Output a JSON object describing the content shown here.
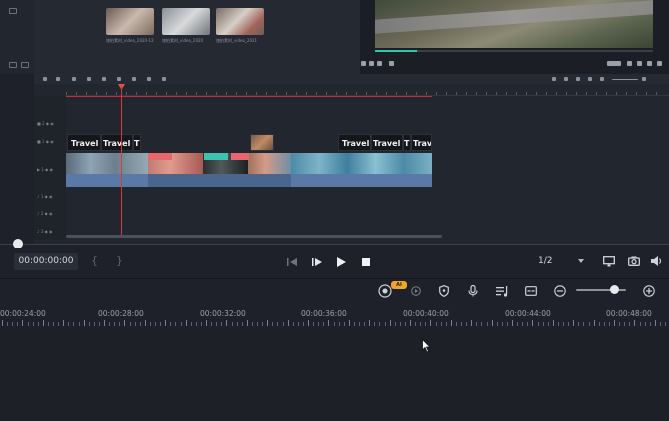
{
  "media": {
    "thumbnails": [
      {
        "caption": "旅拍素材_video_2020-12"
      },
      {
        "caption": "旅拍素材_video_2020"
      },
      {
        "caption": "旅拍素材_video_2021"
      }
    ]
  },
  "preview": {
    "progress": 0.15
  },
  "timeline": {
    "track_labels": [
      "■ 2 ◆ ◉",
      "■ 1 ◆ ◉",
      "▶ 1 ◆ ◉",
      "♪ 1 ◆ ◉",
      "♪ 2 ◆ ◉",
      "♪ 3 ◆ ◉"
    ],
    "title_clips": [
      "Travel",
      "Travel",
      "T",
      "Travel",
      "Travel",
      "T",
      "Trav"
    ]
  },
  "controls": {
    "timecode": "00:00:00:00",
    "mark_in": "{",
    "mark_out": "}",
    "ratio": "1/2",
    "ai_badge": "AI"
  },
  "zoom": {
    "level": 0.7
  },
  "ruler": {
    "labels": [
      "00:00:24:00",
      "00:00:28:00",
      "00:00:32:00",
      "00:00:36:00",
      "00:00:40:00",
      "00:00:44:00",
      "00:00:48:00"
    ]
  },
  "colors": {
    "accent": "#2fc9a8",
    "playhead": "#c9403f",
    "badge": "#f0a52b",
    "audio": "#5a79a6"
  }
}
